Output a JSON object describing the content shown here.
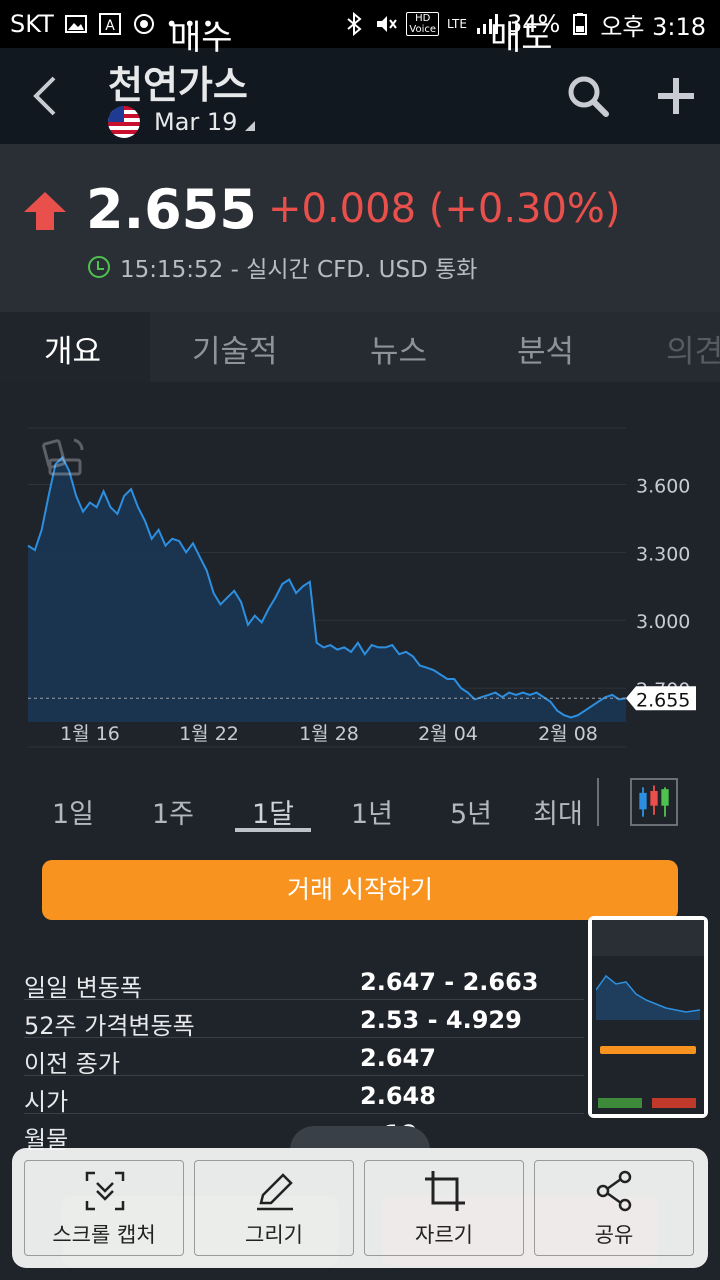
{
  "status_bar": {
    "carrier": "SKT",
    "battery": "34%",
    "time": "오후 3:18",
    "hd_label_top": "HD",
    "hd_label_bottom": "Voice",
    "network": "LTE"
  },
  "header": {
    "title": "천연가스",
    "contract": "Mar 19"
  },
  "quote": {
    "price": "2.655",
    "change": "+0.008 (+0.30%)",
    "info": "15:15:52 - 실시간 CFD. USD 통화",
    "change_color": "#e9504b"
  },
  "tabs": [
    {
      "label": "개요"
    },
    {
      "label": "기술적"
    },
    {
      "label": "뉴스"
    },
    {
      "label": "분석"
    },
    {
      "label": "의견"
    }
  ],
  "chart_data": {
    "type": "area",
    "x_tick_labels": [
      "1월 16",
      "1월 22",
      "1월 28",
      "2월 04",
      "2월 08"
    ],
    "y_tick_labels": [
      "3.600",
      "3.300",
      "3.000",
      "2.700"
    ],
    "ylim": [
      2.55,
      3.85
    ],
    "last_value_label": "2.655",
    "line_color": "#2d8fe0",
    "grid": true,
    "values": [
      3.33,
      3.31,
      3.4,
      3.55,
      3.69,
      3.72,
      3.66,
      3.55,
      3.48,
      3.52,
      3.5,
      3.57,
      3.5,
      3.47,
      3.55,
      3.58,
      3.5,
      3.44,
      3.36,
      3.4,
      3.33,
      3.36,
      3.35,
      3.3,
      3.34,
      3.28,
      3.22,
      3.12,
      3.07,
      3.1,
      3.13,
      3.08,
      2.98,
      3.02,
      2.99,
      3.05,
      3.1,
      3.16,
      3.18,
      3.12,
      3.15,
      3.17,
      2.9,
      2.88,
      2.89,
      2.87,
      2.88,
      2.86,
      2.9,
      2.85,
      2.89,
      2.88,
      2.88,
      2.89,
      2.85,
      2.86,
      2.84,
      2.8,
      2.79,
      2.78,
      2.76,
      2.74,
      2.74,
      2.7,
      2.68,
      2.65,
      2.66,
      2.67,
      2.68,
      2.66,
      2.68,
      2.67,
      2.68,
      2.67,
      2.68,
      2.66,
      2.64,
      2.6,
      2.58,
      2.57,
      2.58,
      2.6,
      2.62,
      2.64,
      2.66,
      2.67,
      2.65,
      2.655
    ]
  },
  "periods": [
    {
      "label": "1일"
    },
    {
      "label": "1주"
    },
    {
      "label": "1달"
    },
    {
      "label": "1년"
    },
    {
      "label": "5년"
    },
    {
      "label": "최대"
    }
  ],
  "trade_button": "거래 시작하기",
  "stats": [
    {
      "label": "일일 변동폭",
      "value": "2.647 - 2.663"
    },
    {
      "label": "52주 가격변동폭",
      "value": "2.53 - 4.929"
    },
    {
      "label": "이전 종가",
      "value": "2.647"
    },
    {
      "label": "시가",
      "value": "2.648"
    },
    {
      "label": "월물",
      "value": "…19"
    }
  ],
  "bottom_actions": {
    "buy": "매수",
    "sell": "매도"
  },
  "toolbar": {
    "scroll_capture": "스크롤 캡처",
    "draw": "그리기",
    "crop": "자르기",
    "share": "공유"
  }
}
